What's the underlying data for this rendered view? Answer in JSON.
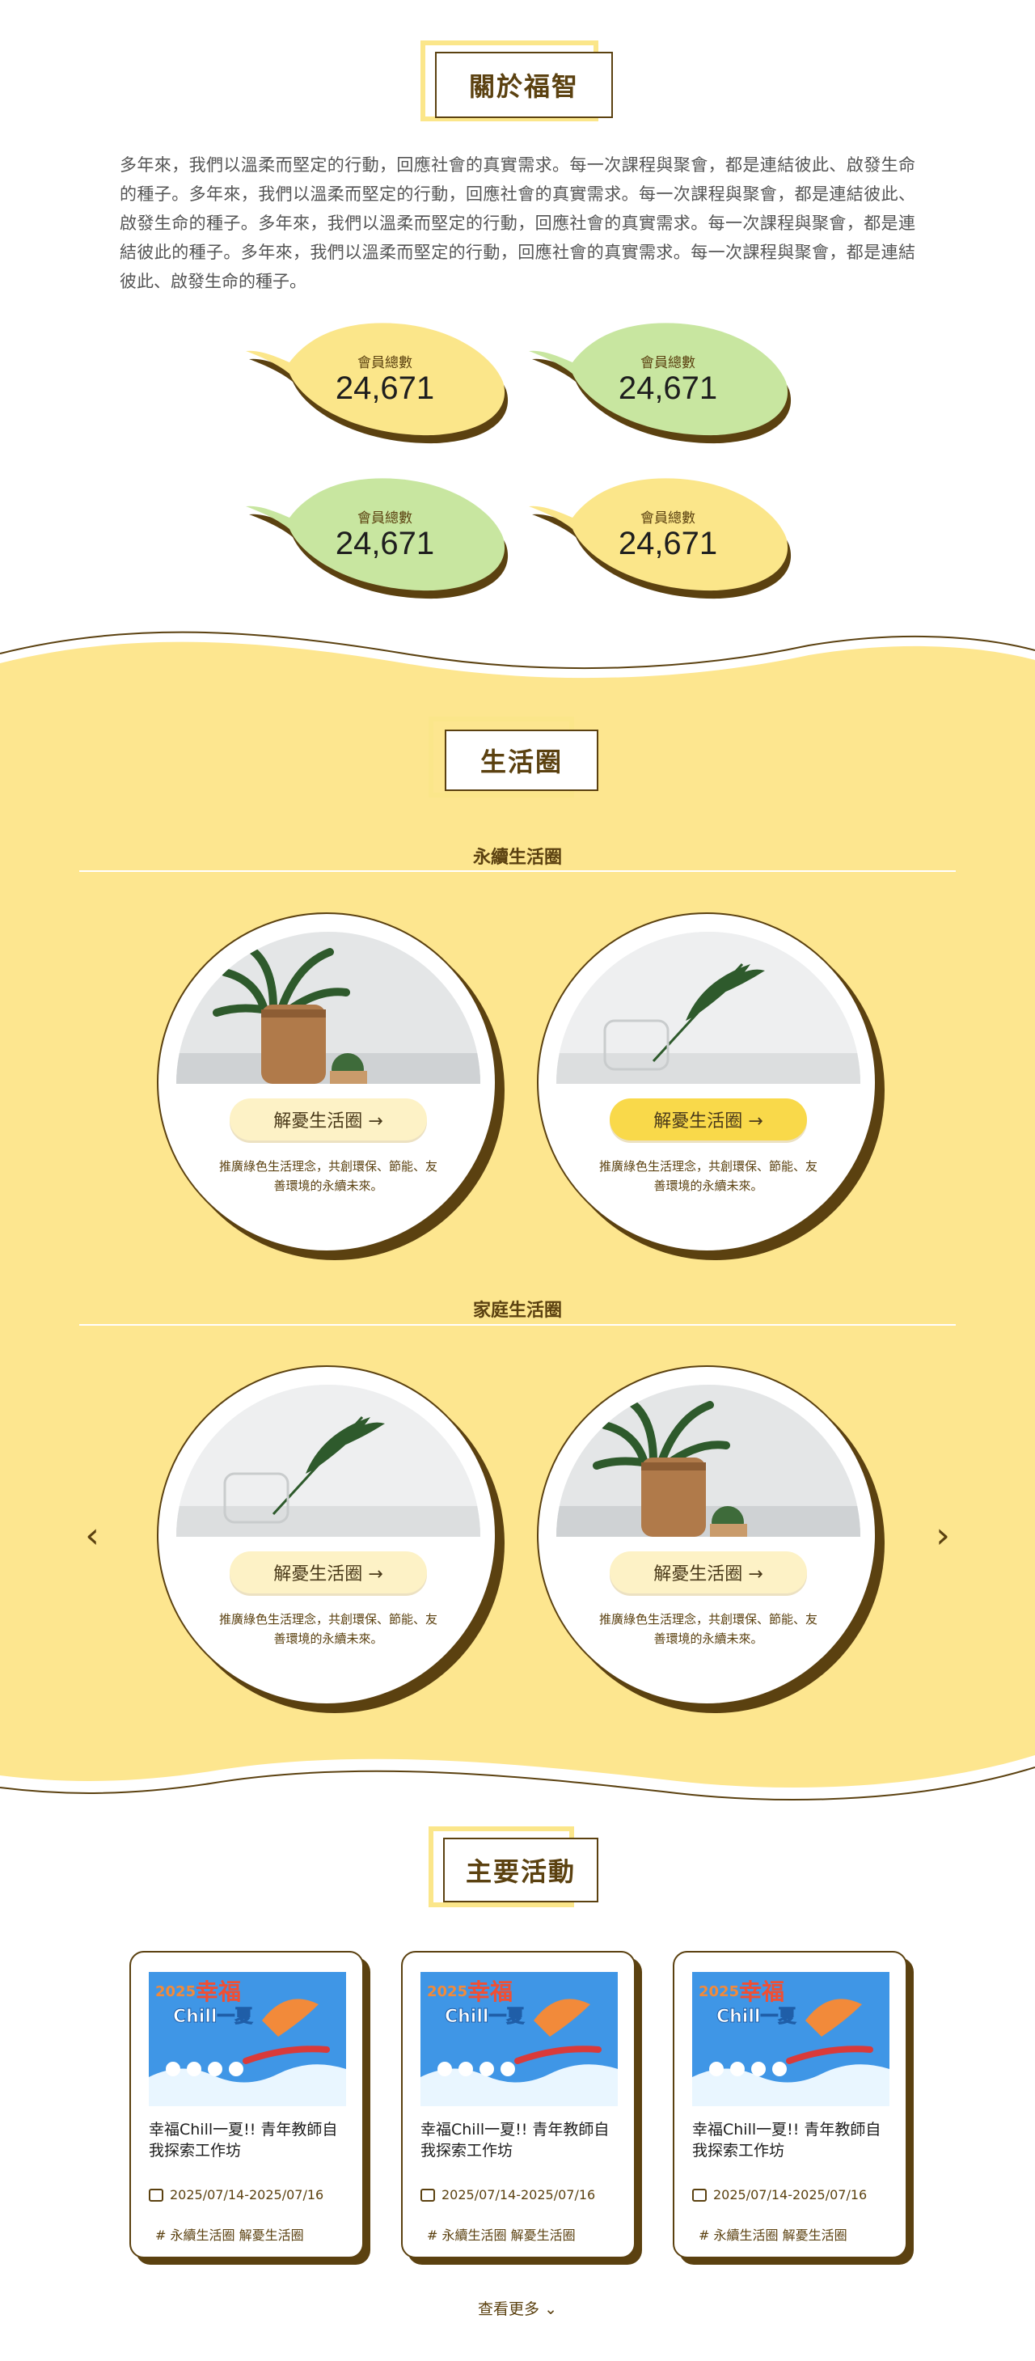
{
  "about": {
    "title": "關於福智",
    "paragraph": "多年來，我們以溫柔而堅定的行動，回應社會的真實需求。每一次課程與聚會，都是連結彼此、啟發生命的種子。多年來，我們以溫柔而堅定的行動，回應社會的真實需求。每一次課程與聚會，都是連結彼此、啟發生命的種子。多年來，我們以溫柔而堅定的行動，回應社會的真實需求。每一次課程與聚會，都是連結彼此的種子。多年來，我們以溫柔而堅定的行動，回應社會的真實需求。每一次課程與聚會，都是連結彼此、啟發生命的種子。",
    "stats": [
      {
        "label": "會員總數",
        "value": "24,671",
        "color": "#fbe68a"
      },
      {
        "label": "會員總數",
        "value": "24,671",
        "color": "#c8e6a0"
      },
      {
        "label": "會員總數",
        "value": "24,671",
        "color": "#c8e6a0"
      },
      {
        "label": "會員總數",
        "value": "24,671",
        "color": "#fbe68a"
      }
    ]
  },
  "life": {
    "title": "生活圈",
    "groups": [
      {
        "heading": "永續生活圈",
        "cards": [
          {
            "button": "解憂生活圈 →",
            "desc": "推廣綠色生活理念，共創環保、節能、友善環境的永續未來。",
            "image": "vase-plant-photo"
          },
          {
            "button": "解憂生活圈 →",
            "desc": "推廣綠色生活理念，共創環保、節能、友善環境的永續未來。",
            "image": "palm-leaf-glass-photo"
          }
        ]
      },
      {
        "heading": "家庭生活圈",
        "cards": [
          {
            "button": "解憂生活圈 →",
            "desc": "推廣綠色生活理念，共創環保、節能、友善環境的永續未來。",
            "image": "palm-leaf-glass-photo"
          },
          {
            "button": "解憂生活圈 →",
            "desc": "推廣綠色生活理念，共創環保、節能、友善環境的永續未來。",
            "image": "vase-plant-photo"
          }
        ]
      }
    ],
    "prev_icon": "‹",
    "next_icon": "›"
  },
  "activities": {
    "title": "主要活動",
    "poster": {
      "year_text": "2025",
      "brand_text": "幸福",
      "sub_text": "Chill一夏"
    },
    "items": [
      {
        "title": "幸福Chill一夏!! 青年教師自我探索工作坊",
        "date": "2025/07/14-2025/07/16",
        "tags": "#  永續生活圈 解憂生活圈"
      },
      {
        "title": "幸福Chill一夏!! 青年教師自我探索工作坊",
        "date": "2025/07/14-2025/07/16",
        "tags": "#  永續生活圈 解憂生活圈"
      },
      {
        "title": "幸福Chill一夏!! 青年教師自我探索工作坊",
        "date": "2025/07/14-2025/07/16",
        "tags": "#  永續生活圈 解憂生活圈"
      }
    ],
    "more": "查看更多"
  },
  "colors": {
    "brand_brown": "#5b4110",
    "band_yellow": "#fde68f",
    "accent_yellow": "#f9d94a"
  }
}
